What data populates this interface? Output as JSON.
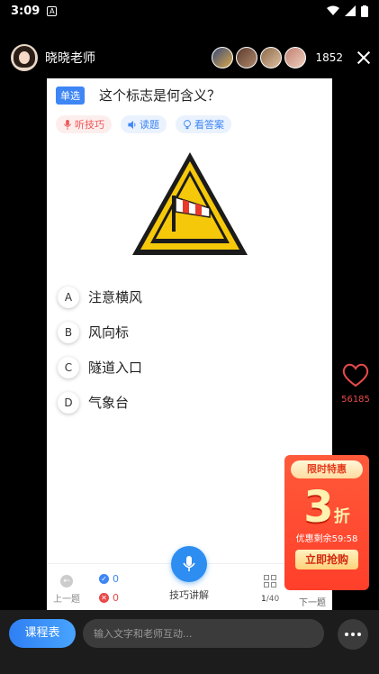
{
  "status": {
    "time": "3:09",
    "notif_icon": "A"
  },
  "header": {
    "anchor_name": "晓晓老师",
    "viewer_count": "1852"
  },
  "question": {
    "type": "单选",
    "title": "这个标志是何含义？",
    "tools": {
      "listen": "听技巧",
      "read": "读题",
      "answer": "看答案"
    },
    "options": [
      {
        "letter": "A",
        "text": "注意横风"
      },
      {
        "letter": "B",
        "text": "风向标"
      },
      {
        "letter": "C",
        "text": "隧道入口"
      },
      {
        "letter": "D",
        "text": "气象台"
      }
    ]
  },
  "card_bottom": {
    "prev": "上一题",
    "correct": "0",
    "wrong": "0",
    "explain": "技巧讲解",
    "page_current": "1",
    "page_total": "/40",
    "next": "下一题"
  },
  "like": {
    "count": "56185"
  },
  "promo": {
    "title": "限时特惠",
    "number": "3",
    "unit": "折",
    "timer": "优惠剩余59:58",
    "button": "立即抢购"
  },
  "bottom_bar": {
    "schedule": "课程表",
    "input_placeholder": "输入文字和老师互动..."
  },
  "colors": {
    "accent": "#3e86f5",
    "danger": "#e84a4a",
    "promo": "#ff4a2e"
  }
}
